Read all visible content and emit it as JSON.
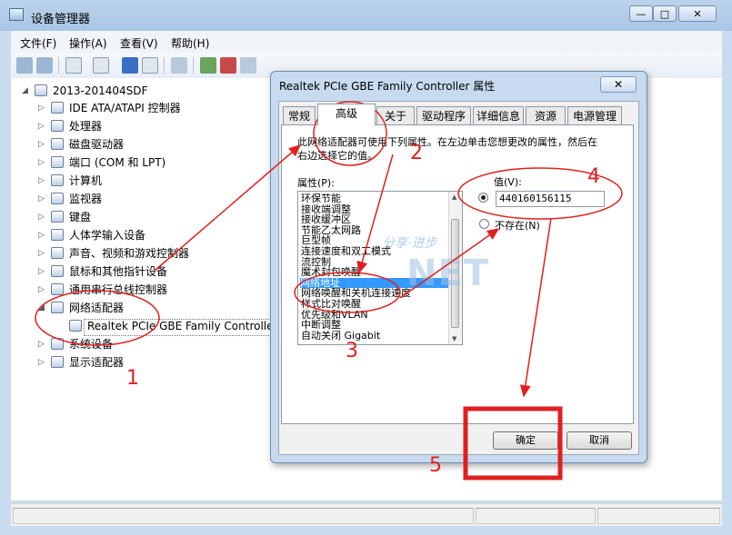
{
  "window": {
    "title": "设备管理器",
    "minimize_label": "—",
    "maximize_label": "□",
    "close_label": "✕"
  },
  "menu": [
    "文件(F)",
    "操作(A)",
    "查看(V)",
    "帮助(H)"
  ],
  "tree": {
    "root": "2013-201404SDF",
    "items": [
      "IDE ATA/ATAPI 控制器",
      "处理器",
      "磁盘驱动器",
      "端口 (COM 和 LPT)",
      "计算机",
      "监视器",
      "键盘",
      "人体学输入设备",
      "声音、视频和游戏控制器",
      "鼠标和其他指针设备",
      "通用串行总线控制器",
      "网络适配器",
      "Realtek PCIe GBE Family Controller",
      "系统设备",
      "显示适配器"
    ]
  },
  "dialog": {
    "title": "Realtek PCIe GBE Family Controller 属性",
    "close_label": "✕",
    "tabs": [
      "常规",
      "高级",
      "关于",
      "驱动程序",
      "详细信息",
      "资源",
      "电源管理"
    ],
    "active_tab": "高级",
    "description": "此网络适配器可使用下列属性。在左边单击您想更改的属性，然后在右边选择它的值。",
    "property_label": "属性(P):",
    "properties": [
      "环保节能",
      "接收端调整",
      "接收缓冲区",
      "节能乙太网路",
      "巨型帧",
      "连接速度和双工模式",
      "流控制",
      "魔术封包唤醒",
      "网络地址",
      "网络唤醒和关机连接速度",
      "样式比对唤醒",
      "优先级和VLAN",
      "中断调整",
      "自动关闭 Gigabit"
    ],
    "selected_property": "网络地址",
    "value_label": "值(V):",
    "value": "440160156115",
    "absent_label": "不存在(N)",
    "ok_label": "确定",
    "cancel_label": "取消"
  },
  "annotations": [
    "1",
    "2",
    "3",
    "4",
    "5"
  ],
  "watermark": {
    "slogan": "分享·进步",
    "logo": "NET"
  },
  "colors": {
    "annotation_red": "#e02020",
    "selection_blue": "#3399ff"
  }
}
